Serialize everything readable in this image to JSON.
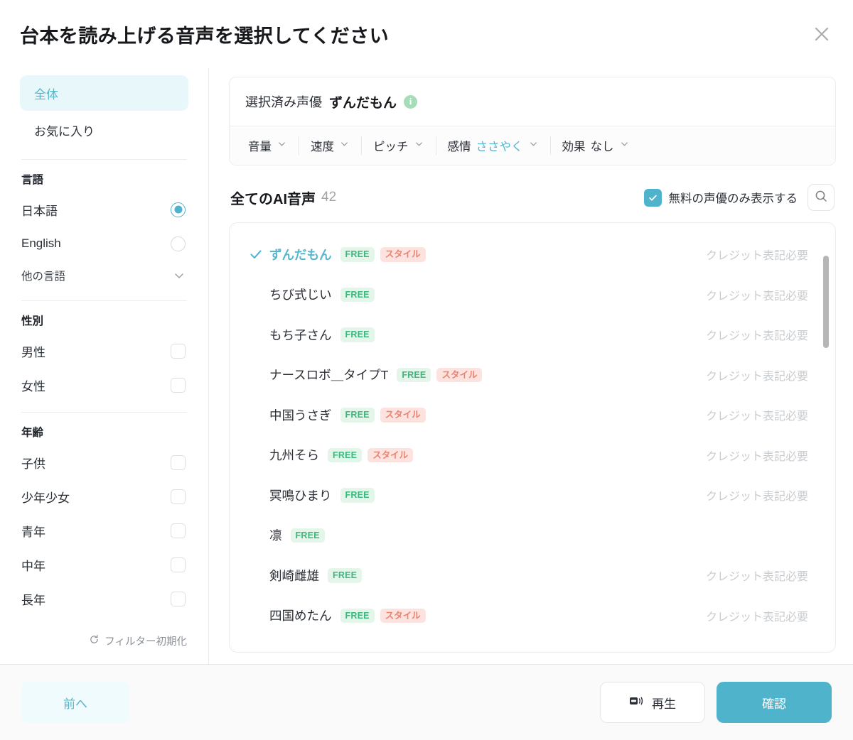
{
  "header": {
    "title": "台本を読み上げる音声を選択してください",
    "close_icon": "close-icon"
  },
  "sidebar": {
    "nav": [
      {
        "label": "全体",
        "active": true
      },
      {
        "label": "お気に入り",
        "active": false
      }
    ],
    "language": {
      "group_title": "言語",
      "options": [
        {
          "label": "日本語",
          "selected": true
        },
        {
          "label": "English",
          "selected": false
        }
      ],
      "more_label": "他の言語"
    },
    "gender": {
      "group_title": "性別",
      "options": [
        {
          "label": "男性",
          "checked": false
        },
        {
          "label": "女性",
          "checked": false
        }
      ]
    },
    "age": {
      "group_title": "年齢",
      "options": [
        {
          "label": "子供",
          "checked": false
        },
        {
          "label": "少年少女",
          "checked": false
        },
        {
          "label": "青年",
          "checked": false
        },
        {
          "label": "中年",
          "checked": false
        },
        {
          "label": "長年",
          "checked": false
        }
      ]
    },
    "reset_label": "フィルター初期化"
  },
  "selected_panel": {
    "label": "選択済み声優",
    "name": "ずんだもん",
    "info_icon": "info-icon",
    "controls": [
      {
        "label": "音量",
        "value": "",
        "highlight": false
      },
      {
        "label": "速度",
        "value": "",
        "highlight": false
      },
      {
        "label": "ピッチ",
        "value": "",
        "highlight": false
      },
      {
        "label": "感情",
        "value": "ささやく",
        "highlight": true
      },
      {
        "label": "効果",
        "value": "なし",
        "highlight": false
      }
    ]
  },
  "list": {
    "title": "全てのAI音声",
    "count": "42",
    "free_only_label": "無料の声優のみ表示する",
    "free_only_checked": true,
    "search_icon": "search-icon",
    "credit_text": "クレジット表記必要",
    "badge_free": "FREE",
    "badge_style": "スタイル",
    "rows": [
      {
        "name": "ずんだもん",
        "selected": true,
        "free": true,
        "style": true,
        "credit": true
      },
      {
        "name": "ちび式じい",
        "selected": false,
        "free": true,
        "style": false,
        "credit": true
      },
      {
        "name": "もち子さん",
        "selected": false,
        "free": true,
        "style": false,
        "credit": true
      },
      {
        "name": "ナースロボ＿タイプT",
        "selected": false,
        "free": true,
        "style": true,
        "credit": true
      },
      {
        "name": "中国うさぎ",
        "selected": false,
        "free": true,
        "style": true,
        "credit": true
      },
      {
        "name": "九州そら",
        "selected": false,
        "free": true,
        "style": true,
        "credit": true
      },
      {
        "name": "冥鳴ひまり",
        "selected": false,
        "free": true,
        "style": false,
        "credit": true
      },
      {
        "name": "凛",
        "selected": false,
        "free": true,
        "style": false,
        "credit": false
      },
      {
        "name": "剣崎雌雄",
        "selected": false,
        "free": true,
        "style": false,
        "credit": true
      },
      {
        "name": "四国めたん",
        "selected": false,
        "free": true,
        "style": true,
        "credit": true
      }
    ]
  },
  "footer": {
    "prev_label": "前へ",
    "play_label": "再生",
    "play_icon": "speaker-icon",
    "confirm_label": "確認"
  },
  "colors": {
    "accent": "#4fb3cc",
    "accent_soft": "#e8f7f9",
    "badge_free_bg": "#e4f5ea",
    "badge_free_fg": "#3cb87f",
    "badge_style_bg": "#fce3df",
    "badge_style_fg": "#ea8370",
    "muted": "#c9cccf"
  }
}
